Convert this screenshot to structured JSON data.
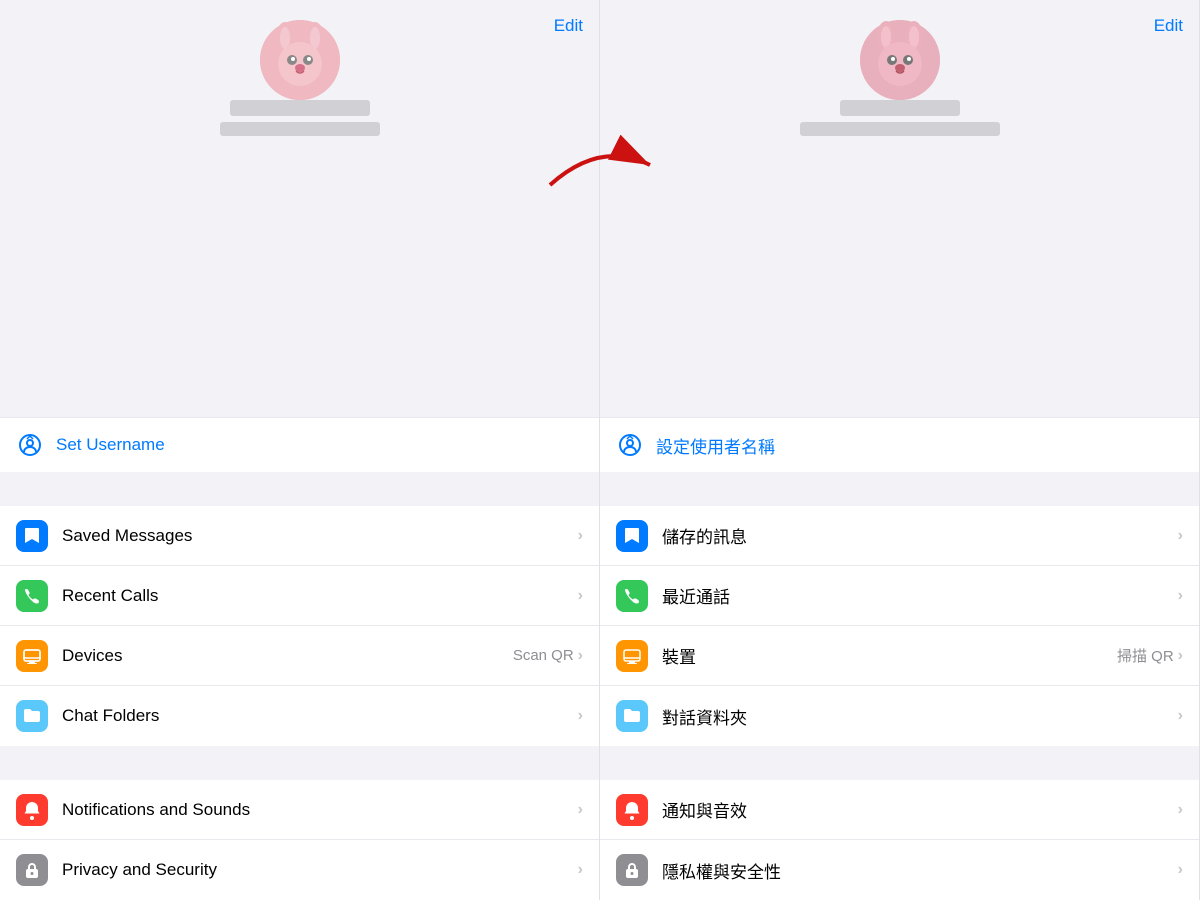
{
  "left": {
    "edit_label": "Edit",
    "username_label": "Set Username",
    "items": [
      {
        "label": "Saved Messages",
        "icon": "bookmark",
        "icon_class": "icon-blue",
        "secondary": "",
        "chevron": "›"
      },
      {
        "label": "Recent Calls",
        "icon": "📞",
        "icon_class": "icon-green",
        "secondary": "",
        "chevron": "›"
      },
      {
        "label": "Devices",
        "icon": "🖥",
        "icon_class": "icon-orange",
        "secondary": "Scan QR",
        "chevron": "›"
      },
      {
        "label": "Chat Folders",
        "icon": "folder",
        "icon_class": "icon-teal",
        "secondary": "",
        "chevron": "›"
      }
    ],
    "items2": [
      {
        "label": "Notifications and Sounds",
        "icon": "bell",
        "icon_class": "icon-red",
        "secondary": "",
        "chevron": "›"
      },
      {
        "label": "Privacy and Security",
        "icon": "lock",
        "icon_class": "icon-gray",
        "secondary": "",
        "chevron": "›"
      }
    ]
  },
  "right": {
    "edit_label": "Edit",
    "username_label": "設定使用者名稱",
    "items": [
      {
        "label": "儲存的訊息",
        "icon": "bookmark",
        "icon_class": "icon-blue",
        "secondary": "",
        "chevron": "›"
      },
      {
        "label": "最近通話",
        "icon": "📞",
        "icon_class": "icon-green",
        "secondary": "",
        "chevron": "›"
      },
      {
        "label": "裝置",
        "icon": "🖥",
        "icon_class": "icon-orange",
        "secondary": "掃描 QR",
        "chevron": "›"
      },
      {
        "label": "對話資料夾",
        "icon": "folder",
        "icon_class": "icon-teal",
        "secondary": "",
        "chevron": "›"
      }
    ],
    "items2": [
      {
        "label": "通知與音效",
        "icon": "bell",
        "icon_class": "icon-red",
        "secondary": "",
        "chevron": "›"
      },
      {
        "label": "隱私權與安全性",
        "icon": "lock",
        "icon_class": "icon-gray",
        "secondary": "",
        "chevron": "›"
      }
    ]
  }
}
